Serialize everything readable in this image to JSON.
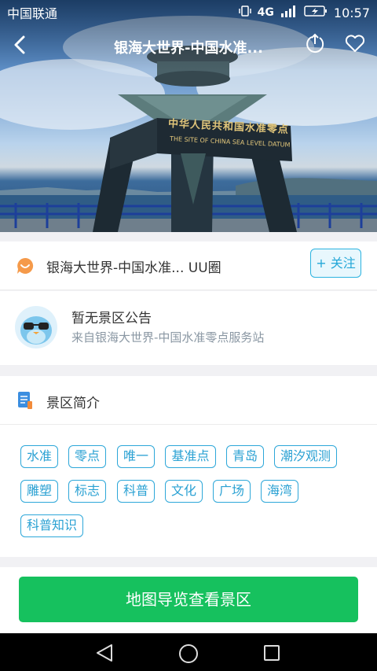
{
  "status_bar": {
    "carrier": "中国联通",
    "network": "4G",
    "time": "10:57"
  },
  "header": {
    "title": "银海大世界-中国水准..."
  },
  "hero": {
    "monument_caption_cn": "中华人民共和国水准零点",
    "monument_caption_en": "THE SITE OF CHINA SEA LEVEL DATUM"
  },
  "uu_circle": {
    "name": "银海大世界-中国水准... UU圈",
    "follow_label": "+ 关注"
  },
  "notice": {
    "title": "暂无景区公告",
    "source": "来自银海大世界-中国水准零点服务站"
  },
  "intro": {
    "title": "景区简介",
    "tags": [
      "水准",
      "零点",
      "唯一",
      "基准点",
      "青岛",
      "潮汐观测",
      "雕塑",
      "标志",
      "科普",
      "文化",
      "广场",
      "海湾",
      "科普知识"
    ]
  },
  "bottom": {
    "button_label": "地图导览查看景区"
  },
  "colors": {
    "accent": "#2aa1d3",
    "button": "#16c15e"
  }
}
